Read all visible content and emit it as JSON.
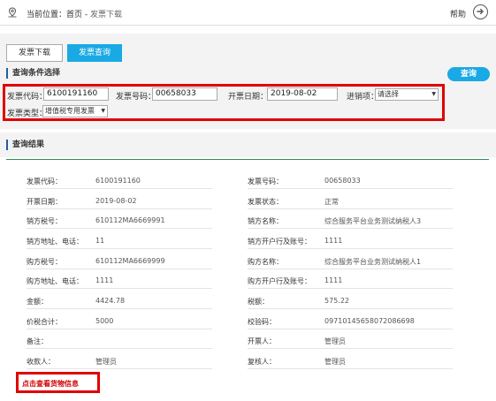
{
  "breadcrumb": {
    "prefix": "当前位置：首页 - ",
    "current": "发票下载"
  },
  "help": {
    "label": "帮助"
  },
  "tabs": [
    {
      "label": "发票下载",
      "active": false
    },
    {
      "label": "发票查询",
      "active": true
    }
  ],
  "query_section": {
    "title": "查询条件选择",
    "query_button": "查询",
    "fields": {
      "invoice_code_label": "发票代码：",
      "invoice_code_value": "6100191160",
      "invoice_number_label": "发票号码：",
      "invoice_number_value": "00658033",
      "issue_date_label": "开票日期：",
      "issue_date_value": "2019-08-02",
      "direction_label": "进销项：",
      "direction_value": "请选择",
      "type_label": "发票类型：",
      "type_value": "增值税专用发票"
    }
  },
  "result_section": {
    "title": "查询结果",
    "left": [
      {
        "label": "发票代码：",
        "value": "6100191160"
      },
      {
        "label": "开票日期：",
        "value": "2019-08-02"
      },
      {
        "label": "销方税号：",
        "value": "610112MA6669991"
      },
      {
        "label": "销方地址、电话：",
        "value": "11"
      },
      {
        "label": "购方税号：",
        "value": "610112MA6669999"
      },
      {
        "label": "购方地址、电话：",
        "value": "1111"
      },
      {
        "label": "金额：",
        "value": "4424.78"
      },
      {
        "label": "价税合计：",
        "value": "5000"
      },
      {
        "label": "备注：",
        "value": ""
      },
      {
        "label": "收款人：",
        "value": "管理员"
      }
    ],
    "right": [
      {
        "label": "发票号码：",
        "value": "00658033"
      },
      {
        "label": "发票状态：",
        "value": "正常"
      },
      {
        "label": "销方名称：",
        "value": "综合服务平台业务测试纳税人3"
      },
      {
        "label": "销方开户行及账号：",
        "value": "1111"
      },
      {
        "label": "购方名称：",
        "value": "综合服务平台业务测试纳税人1"
      },
      {
        "label": "购方开户行及账号：",
        "value": "1111"
      },
      {
        "label": "税额：",
        "value": "575.22"
      },
      {
        "label": "校验码：",
        "value": "09710145658072086698"
      },
      {
        "label": "开票人：",
        "value": "管理员"
      },
      {
        "label": "复核人：",
        "value": "管理员"
      }
    ],
    "view_goods_link": "点击查看货物信息"
  },
  "colors": {
    "accent": "#19a9e4",
    "highlight": "#e00000",
    "section_marker": "#1b5fa7",
    "result_line": "#2e8b57"
  }
}
